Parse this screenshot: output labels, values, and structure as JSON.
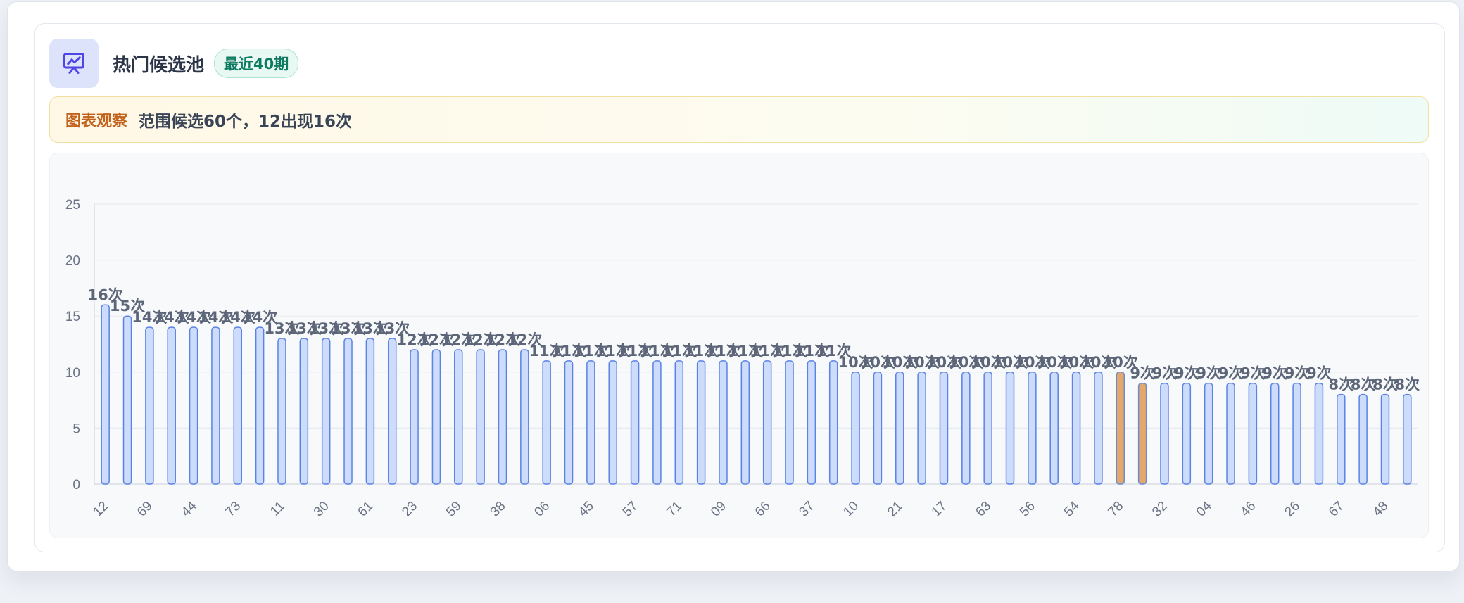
{
  "header": {
    "title": "热门候选池",
    "badge": "最近40期",
    "icon": "presentation-chart-icon"
  },
  "observation": {
    "label": "图表观察",
    "text": "范围候选60个，12出现16次"
  },
  "colors": {
    "bar_fill": "#cddcfb",
    "bar_stroke": "#5b83e6",
    "highlight_fill": "#e3a86a",
    "highlight_stroke": "#6e8ad4",
    "label": "#5c6678"
  },
  "chart_data": {
    "type": "bar",
    "title": "",
    "xlabel": "",
    "ylabel": "",
    "ylim": [
      0,
      25
    ],
    "yticks": [
      0,
      5,
      10,
      15,
      20,
      25
    ],
    "grid": true,
    "x_tick_labels": [
      "12",
      "69",
      "44",
      "73",
      "11",
      "30",
      "61",
      "23",
      "59",
      "38",
      "06",
      "45",
      "57",
      "71",
      "09",
      "66",
      "37",
      "10",
      "21",
      "17",
      "63",
      "56",
      "54",
      "78",
      "32",
      "04",
      "46",
      "26",
      "67",
      "48"
    ],
    "values": [
      16,
      15,
      14,
      14,
      14,
      14,
      14,
      14,
      13,
      13,
      13,
      13,
      13,
      13,
      12,
      12,
      12,
      12,
      12,
      12,
      11,
      11,
      11,
      11,
      11,
      11,
      11,
      11,
      11,
      11,
      11,
      11,
      11,
      11,
      10,
      10,
      10,
      10,
      10,
      10,
      10,
      10,
      10,
      10,
      10,
      10,
      10,
      9,
      9,
      9,
      9,
      9,
      9,
      9,
      9,
      9,
      8,
      8,
      8,
      8
    ],
    "highlighted_indices": [
      46,
      47
    ],
    "label_suffix": "次"
  }
}
